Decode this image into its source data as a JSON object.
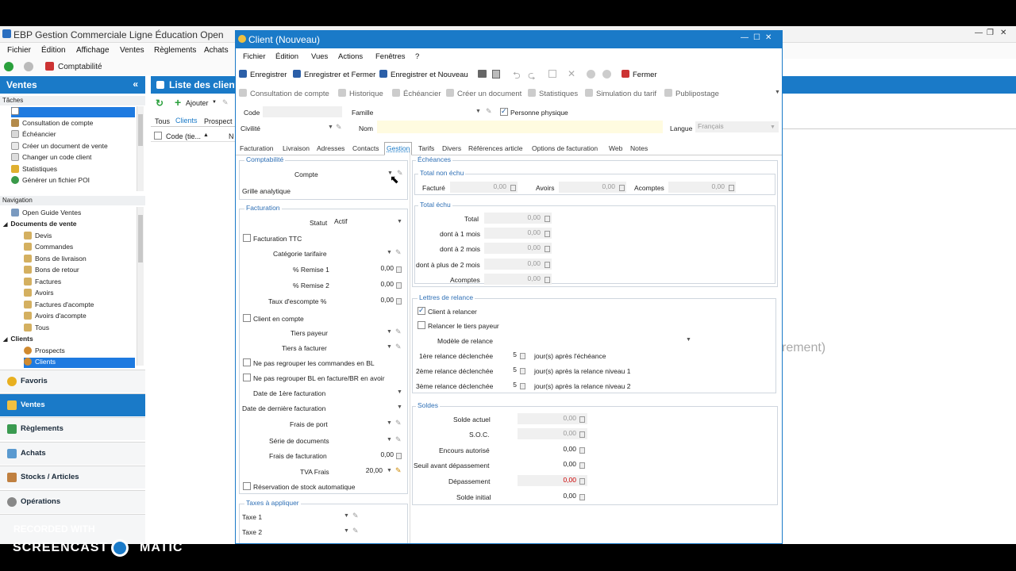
{
  "app": {
    "bg_title": "EBP Gestion Commerciale Ligne Éducation Open",
    "menu": [
      "Fichier",
      "Édition",
      "Affichage",
      "Ventes",
      "Règlements",
      "Achats"
    ],
    "toolbar_label": "Comptabilité",
    "section_title": "Ventes",
    "tasks_label": "Tâches",
    "tasks": [
      "Consultation de compte",
      "Échéancier",
      "Créer un document de vente",
      "Changer un code client",
      "Statistiques",
      "Générer un fichier POI"
    ],
    "nav_label": "Navigation",
    "nav": {
      "open_guide": "Open Guide Ventes",
      "docs_header": "Documents de vente",
      "docs": [
        "Devis",
        "Commandes",
        "Bons de livraison",
        "Bons de retour",
        "Factures",
        "Avoirs",
        "Factures d'acompte",
        "Avoirs d'acompte",
        "Tous"
      ],
      "clients_header": "Clients",
      "clients": [
        "Prospects",
        "Clients"
      ]
    },
    "bottom_nav": [
      "Favoris",
      "Ventes",
      "Règlements",
      "Achats",
      "Stocks / Articles",
      "Opérations"
    ],
    "list_title": "Liste des client",
    "list_add": "Ajouter",
    "list_tabs": [
      "Tous",
      "Clients",
      "Prospect"
    ],
    "list_col": "Code (tie...",
    "ghost_text": "rement)"
  },
  "dialog": {
    "title": "Client (Nouveau)",
    "menu": [
      "Fichier",
      "Édition",
      "Vues",
      "Actions",
      "Fenêtres",
      "?"
    ],
    "toolbar": [
      "Enregistrer",
      "Enregistrer et Fermer",
      "Enregistrer et Nouveau",
      "Fermer"
    ],
    "toolbar2": [
      "Consultation de compte",
      "Historique",
      "Échéancier",
      "Créer un document",
      "Statistiques",
      "Simulation du tarif",
      "Publipostage"
    ],
    "header": {
      "code_label": "Code",
      "famille_label": "Famille",
      "personne_physique": "Personne physique",
      "civilite_label": "Civilité",
      "nom_label": "Nom",
      "langue_label": "Langue",
      "langue_value": "Français"
    },
    "tabs": [
      "Facturation",
      "Livraison",
      "Adresses",
      "Contacts",
      "Gestion",
      "Tarifs",
      "Divers",
      "Références article",
      "Options de facturation",
      "Web",
      "Notes"
    ],
    "comptabilite": {
      "title": "Comptabilité",
      "compte": "Compte",
      "grille": "Grille analytique"
    },
    "facturation": {
      "title": "Facturation",
      "statut_label": "Statut",
      "statut_value": "Actif",
      "facturation_ttc": "Facturation TTC",
      "categorie": "Catégorie tarifaire",
      "remise1": "% Remise 1",
      "remise1_value": "0,00",
      "remise2": "% Remise 2",
      "remise2_value": "0,00",
      "escompte": "Taux d'escompte %",
      "escompte_value": "0,00",
      "client_compte": "Client en compte",
      "tiers_payeur": "Tiers payeur",
      "tiers_facturer": "Tiers à facturer",
      "ne_pas_cmd": "Ne pas regrouper les commandes en BL",
      "ne_pas_bl": "Ne pas regrouper BL en facture/BR en avoir",
      "date_1ere": "Date de 1ère facturation",
      "date_derniere": "Date de dernière facturation",
      "frais_port": "Frais de port",
      "serie": "Série de documents",
      "frais_fact": "Frais de facturation",
      "frais_fact_value": "0,00",
      "tva_frais": "TVA Frais",
      "tva_frais_value": "20,00",
      "reservation": "Réservation de stock automatique"
    },
    "taxes": {
      "title": "Taxes à appliquer",
      "taxe1": "Taxe 1",
      "taxe2": "Taxe 2"
    },
    "echeances": {
      "title": "Échéances",
      "non_echu_title": "Total non échu",
      "facture": "Facturé",
      "facture_value": "0,00",
      "avoirs": "Avoirs",
      "avoirs_value": "0,00",
      "acomptes": "Acomptes",
      "acomptes_value": "0,00",
      "echu_title": "Total échu",
      "rows": [
        {
          "label": "Total",
          "value": "0,00"
        },
        {
          "label": "dont à 1 mois",
          "value": "0,00"
        },
        {
          "label": "dont à 2 mois",
          "value": "0,00"
        },
        {
          "label": "dont à plus de 2 mois",
          "value": "0,00"
        },
        {
          "label": "Acomptes",
          "value": "0,00"
        }
      ]
    },
    "relance": {
      "title": "Lettres de relance",
      "client_relancer": "Client à relancer",
      "relancer_tiers": "Relancer le tiers payeur",
      "modele": "Modèle de relance",
      "r1_label": "1ère relance déclenchée",
      "r1_value": "5",
      "r1_suffix": "jour(s) après l'échéance",
      "r2_label": "2ème relance déclenchée",
      "r2_value": "5",
      "r2_suffix": "jour(s) après la relance niveau 1",
      "r3_label": "3ème relance déclenchée",
      "r3_value": "5",
      "r3_suffix": "jour(s) après la relance niveau 2"
    },
    "soldes": {
      "title": "Soldes",
      "rows": [
        {
          "label": "Solde actuel",
          "value": "0,00"
        },
        {
          "label": "S.O.C.",
          "value": "0,00"
        },
        {
          "label": "Encours autorisé",
          "value": "0,00"
        },
        {
          "label": "Seuil avant dépassement",
          "value": "0,00"
        },
        {
          "label": "Dépassement",
          "value": "0,00"
        },
        {
          "label": "Solde initial",
          "value": "0,00"
        }
      ]
    }
  },
  "watermark": {
    "line1": "RECORDED WITH",
    "line2a": "SCREENCAST",
    "line2b": "MATIC"
  },
  "colors": {
    "accent": "#1a7ac8",
    "yellow_field": "#fffbe0"
  }
}
